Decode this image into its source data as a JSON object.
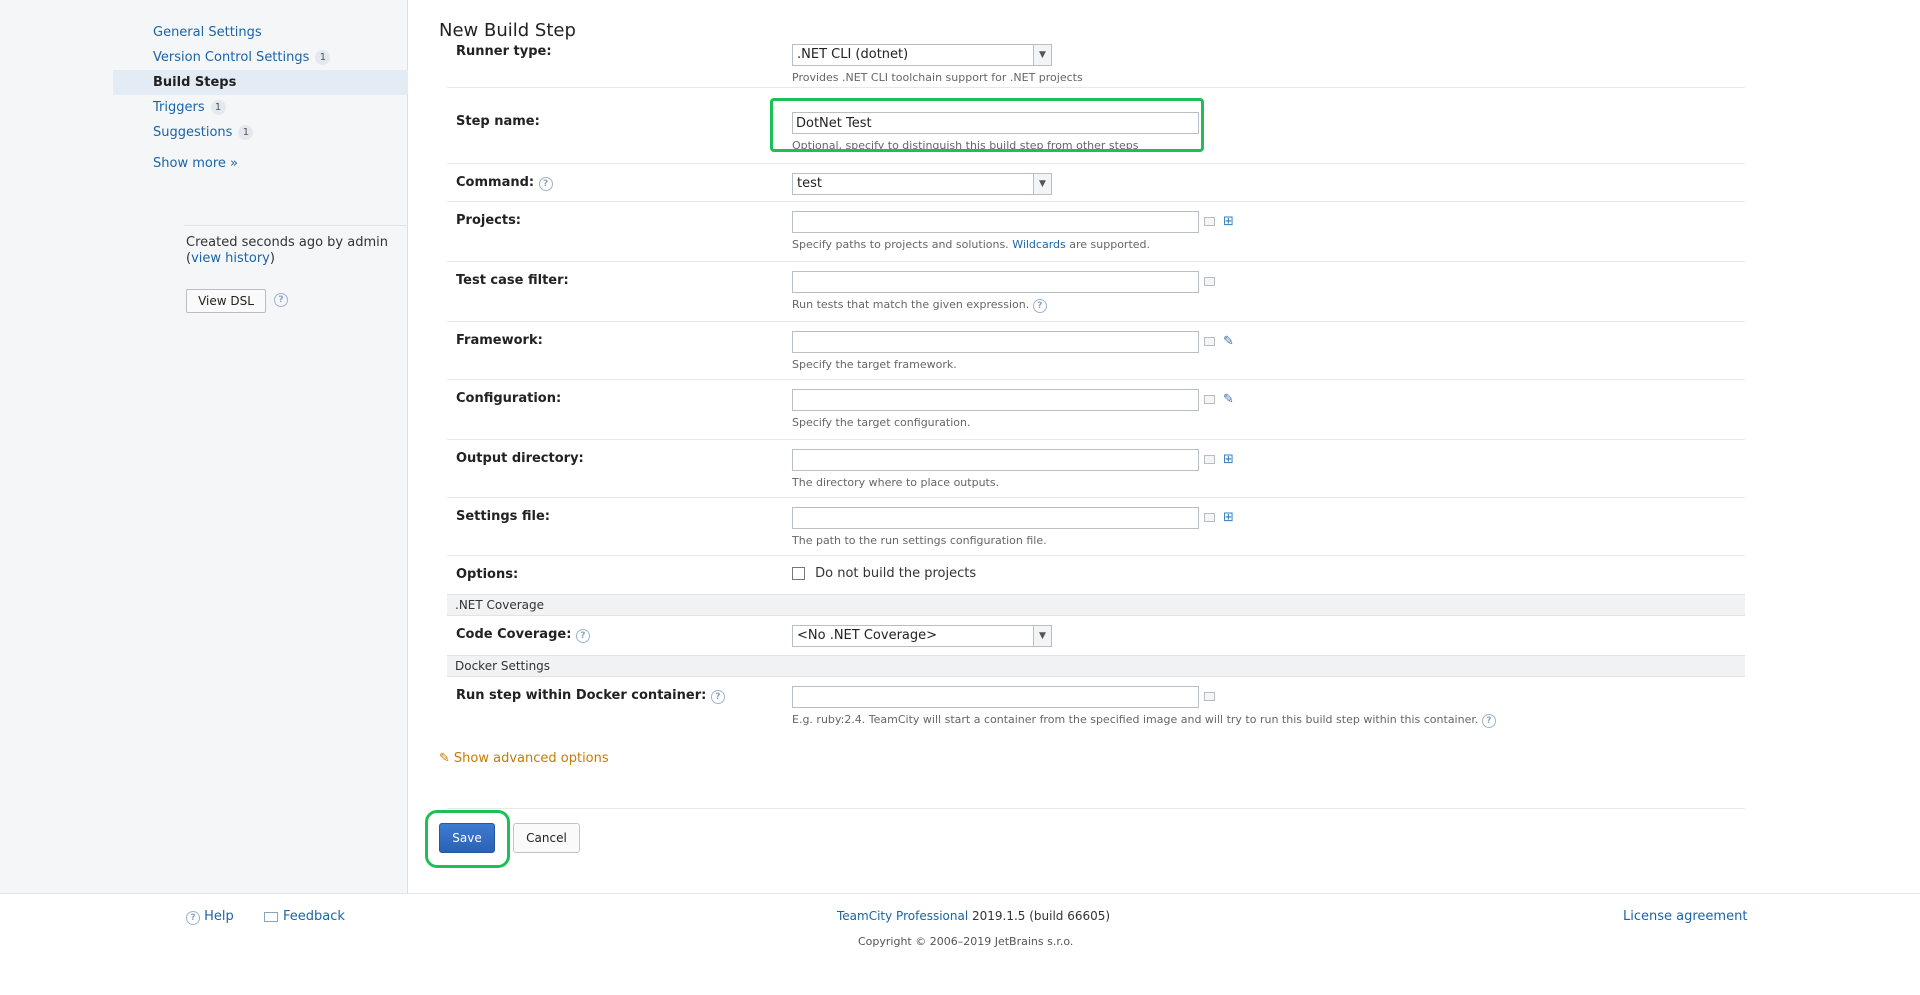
{
  "sidebar": {
    "items": [
      {
        "label": "General Settings",
        "badge": ""
      },
      {
        "label": "Version Control Settings",
        "badge": "1"
      },
      {
        "label": "Build Steps",
        "badge": ""
      },
      {
        "label": "Triggers",
        "badge": "1"
      },
      {
        "label": "Suggestions",
        "badge": "1"
      }
    ],
    "show_more": "Show more »",
    "created_text": "Created seconds ago by admin",
    "view_history": "view history",
    "view_dsl": "View DSL"
  },
  "page": {
    "title": "New Build Step"
  },
  "form": {
    "runner_type": {
      "label": "Runner type:",
      "value": ".NET CLI (dotnet)",
      "hint": "Provides .NET CLI toolchain support for .NET projects"
    },
    "step_name": {
      "label": "Step name:",
      "value": "DotNet Test",
      "hint": "Optional, specify to distinguish this build step from other steps"
    },
    "command": {
      "label": "Command:",
      "value": "test"
    },
    "projects": {
      "label": "Projects:",
      "value": "",
      "hint_pre": "Specify paths to projects and solutions. ",
      "hint_link": "Wildcards",
      "hint_post": " are supported."
    },
    "test_case_filter": {
      "label": "Test case filter:",
      "value": "",
      "hint": "Run tests that match the given expression."
    },
    "framework": {
      "label": "Framework:",
      "value": "",
      "hint": "Specify the target framework."
    },
    "configuration": {
      "label": "Configuration:",
      "value": "",
      "hint": "Specify the target configuration."
    },
    "output_directory": {
      "label": "Output directory:",
      "value": "",
      "hint": "The directory where to place outputs."
    },
    "settings_file": {
      "label": "Settings file:",
      "value": "",
      "hint": "The path to the run settings configuration file."
    },
    "options": {
      "label": "Options:",
      "checkbox_label": "Do not build the projects"
    },
    "coverage_section": ".NET Coverage",
    "code_coverage": {
      "label": "Code Coverage:",
      "value": "<No .NET Coverage>"
    },
    "docker_section": "Docker Settings",
    "docker": {
      "label": "Run step within Docker container:",
      "value": "",
      "hint": "E.g. ruby:2.4. TeamCity will start a container from the specified image and will try to run this build step within this container."
    },
    "advanced": "Show advanced options",
    "save": "Save",
    "cancel": "Cancel"
  },
  "footer": {
    "help": "Help",
    "feedback": "Feedback",
    "product_link": "TeamCity Professional",
    "version": " 2019.1.5 (build 66605)",
    "copyright": "Copyright © 2006–2019 JetBrains s.r.o.",
    "license": "License agreement"
  },
  "colors": {
    "highlight": "#1fbf57",
    "link": "#1a64a7",
    "save_button": "#2a62b5",
    "advanced_link": "#c57c00"
  }
}
